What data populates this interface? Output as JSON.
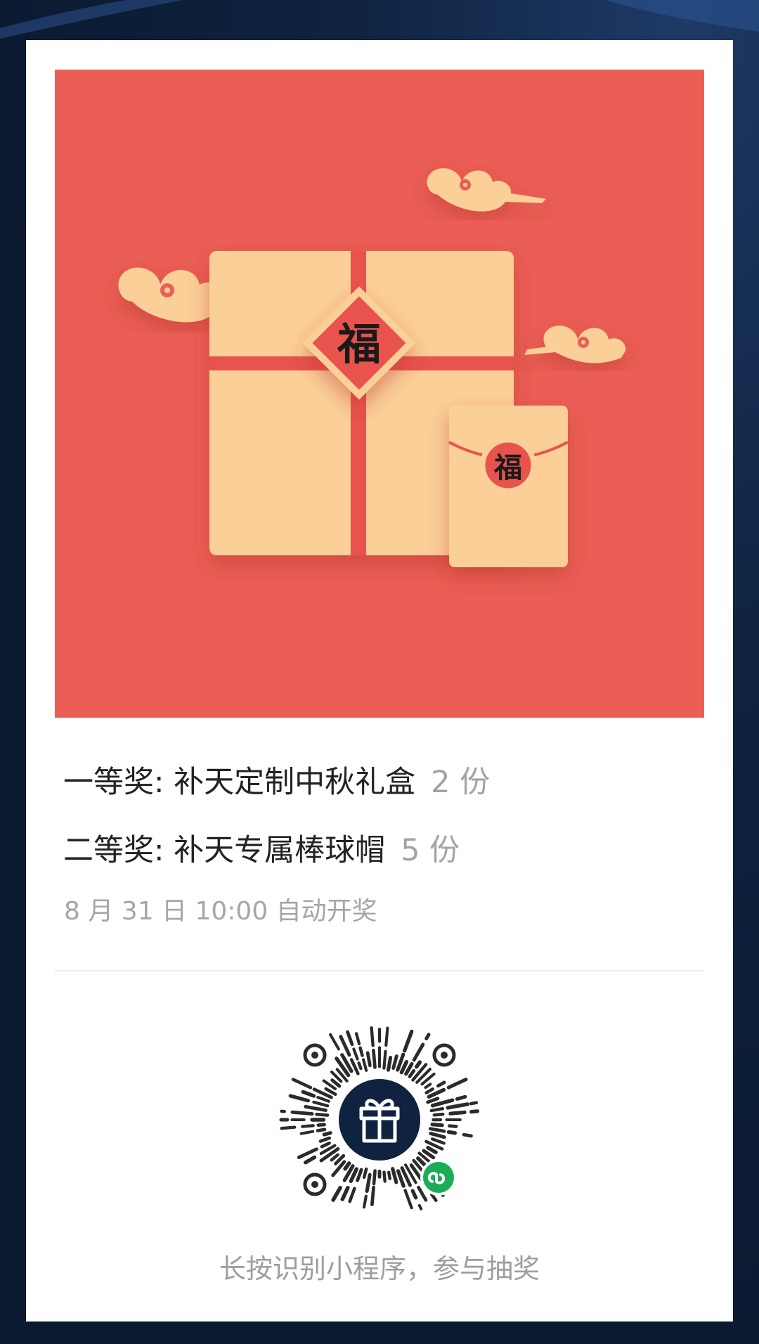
{
  "poster": {
    "banner": {
      "box_character": "福",
      "envelope_character": "福",
      "colors": {
        "background": "#ea5e55",
        "gift": "#fbcf98",
        "ribbon": "#e8534d"
      }
    },
    "prizes": [
      {
        "tier": "一等奖: 补天定制中秋礼盒",
        "count": "2 份"
      },
      {
        "tier": "二等奖: 补天专属棒球帽",
        "count": "5 份"
      }
    ],
    "draw_time": "8 月 31 日 10:00 自动开奖",
    "qr": {
      "center_icon": "gift-icon",
      "badge_icon": "mini-program-link-icon",
      "badge_color": "#1aad54"
    },
    "hint": "长按识别小程序，参与抽奖"
  }
}
